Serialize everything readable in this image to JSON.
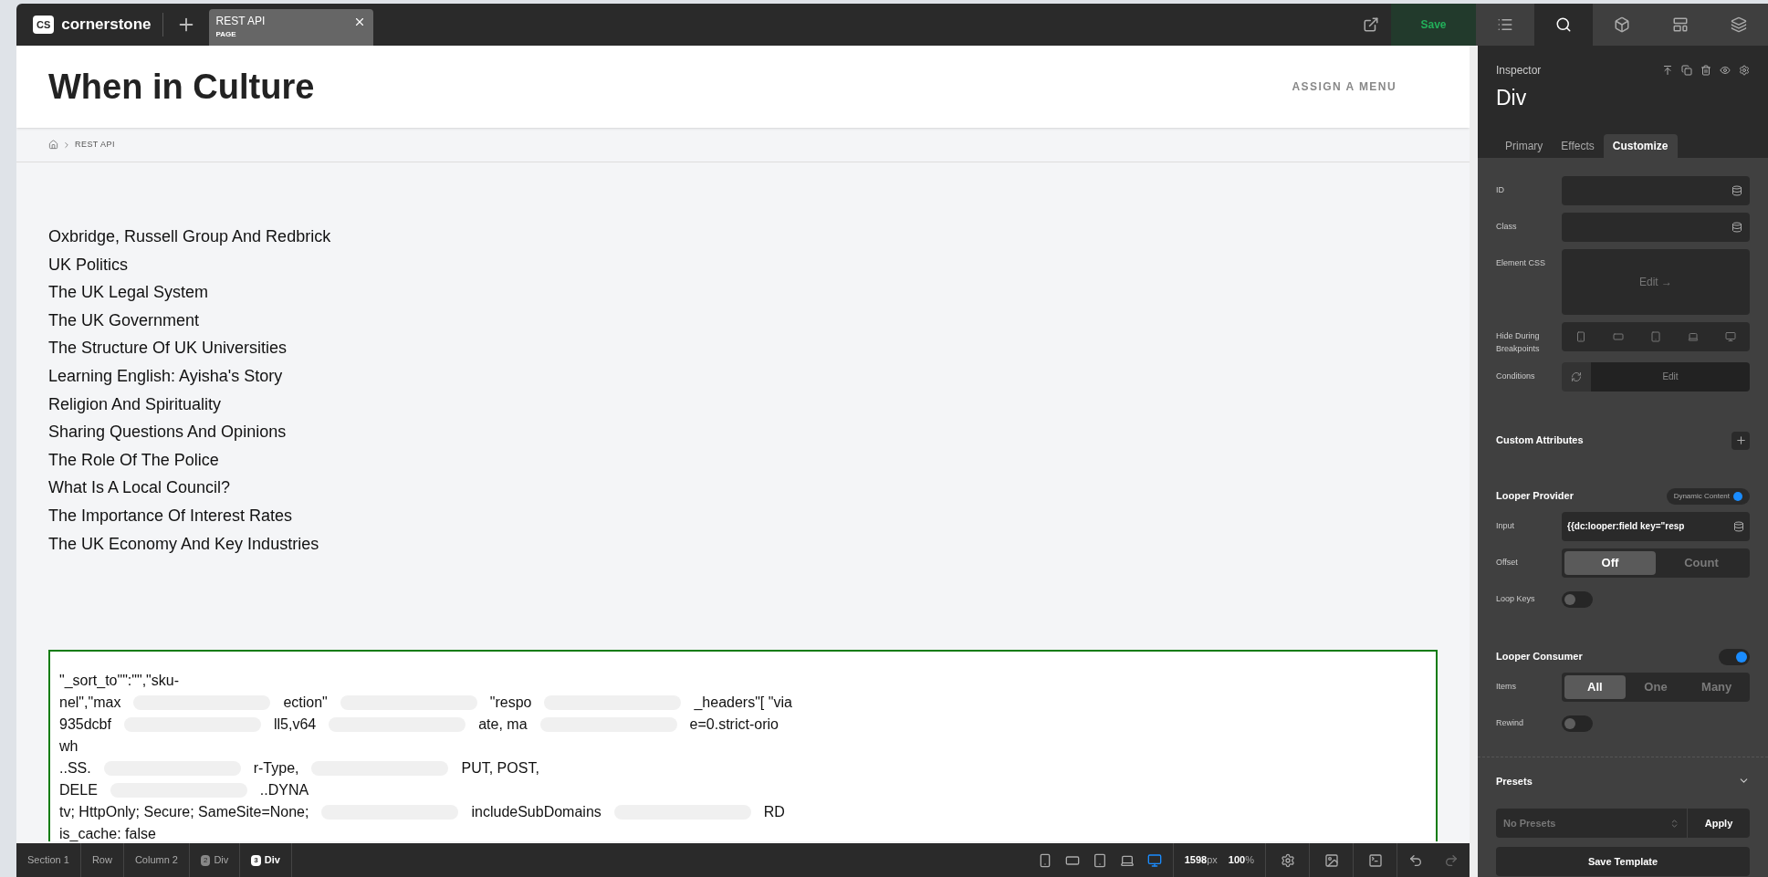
{
  "topbar": {
    "logo_badge": "CS",
    "logo_text": "cornerstone",
    "tab": {
      "title": "REST API",
      "subtitle": "PAGE"
    },
    "save": "Save",
    "panel_tabs": [
      {
        "kind": "list",
        "selected": false
      },
      {
        "kind": "search",
        "selected": true
      },
      {
        "kind": "box",
        "selected": false
      },
      {
        "kind": "layout",
        "selected": false
      },
      {
        "kind": "layers",
        "selected": false
      }
    ]
  },
  "site": {
    "title": "When in Culture",
    "menu": "ASSIGN A MENU",
    "breadcrumb": "REST API"
  },
  "links": [
    "Oxbridge, Russell Group And Redbrick",
    "UK Politics",
    "The UK Legal System",
    "The UK Government",
    "The Structure Of UK Universities",
    "Learning English: Ayisha's Story",
    "Religion And Spirituality",
    "Sharing Questions And Opinions",
    "The Role Of The Police",
    "What Is A Local Council?",
    "The Importance Of Interest Rates",
    "The UK Economy And Key Industries"
  ],
  "output_lines": [
    [
      "\"_sort_to\"\":\"\",\"sku-"
    ],
    [
      "nel\",\"max",
      "ection\"",
      "\"respo",
      "_headers\"[ \"via"
    ],
    [
      "935dcbf",
      "ll5,v64",
      " ate, ma",
      "e=0.strict-orio"
    ],
    [
      "wh"
    ],
    [
      "..SS.",
      "r-Type,",
      "PUT, POST,"
    ],
    [
      "DELE",
      "..DYNA"
    ],
    [
      "tv; HttpOnly; Secure; SameSite=None;",
      "includeSubDomains",
      "RD"
    ],
    [
      "is_cache: false"
    ]
  ],
  "inspector": {
    "label": "Inspector",
    "title": "Div",
    "tabs": [
      {
        "label": "Primary",
        "selected": false
      },
      {
        "label": "Effects",
        "selected": false
      },
      {
        "label": "Customize",
        "selected": true
      }
    ],
    "fields": [
      {
        "kind": "text",
        "label": "ID"
      },
      {
        "kind": "text",
        "label": "Class"
      },
      {
        "kind": "css",
        "label": "Element CSS",
        "action": "Edit →"
      },
      {
        "kind": "breakpoints",
        "label": "Hide During Breakpoints"
      },
      {
        "kind": "conditions",
        "label": "Conditions",
        "action": "Edit"
      }
    ],
    "custom_attributes": "Custom Attributes",
    "provider": {
      "title": "Looper Provider",
      "badge": "Dynamic Content",
      "badge_on": true,
      "input_label": "Input",
      "input_value": "{{dc:looper:field key=\"resp",
      "offset_label": "Offset",
      "offset_options": [
        {
          "label": "Off",
          "selected": true
        },
        {
          "label": "Count",
          "selected": false
        }
      ],
      "loop_keys_label": "Loop Keys",
      "loop_keys_on": false
    },
    "consumer": {
      "title": "Looper Consumer",
      "on": true,
      "items_label": "Items",
      "items_options": [
        {
          "label": "All",
          "selected": true
        },
        {
          "label": "One",
          "selected": false
        },
        {
          "label": "Many",
          "selected": false
        }
      ],
      "rewind_label": "Rewind",
      "rewind_on": false
    },
    "presets": {
      "title": "Presets",
      "placeholder": "No Presets",
      "apply": "Apply",
      "save_template": "Save Template"
    }
  },
  "bottombar": {
    "crumbs": [
      {
        "label": "Section 1",
        "selected": false
      },
      {
        "label": "Row",
        "selected": false
      },
      {
        "label": "Column 2",
        "selected": false
      },
      {
        "label": "Div",
        "badge": "2",
        "selected": false
      },
      {
        "label": "Div",
        "badge": "3",
        "selected": true
      }
    ],
    "devices": [
      {
        "kind": "phone",
        "selected": false
      },
      {
        "kind": "phone-wide",
        "selected": false
      },
      {
        "kind": "tablet",
        "selected": false
      },
      {
        "kind": "laptop",
        "selected": false
      },
      {
        "kind": "desktop",
        "selected": true
      }
    ],
    "width_value": "1598",
    "width_unit": "px",
    "zoom_value": "100",
    "zoom_unit": "%"
  }
}
